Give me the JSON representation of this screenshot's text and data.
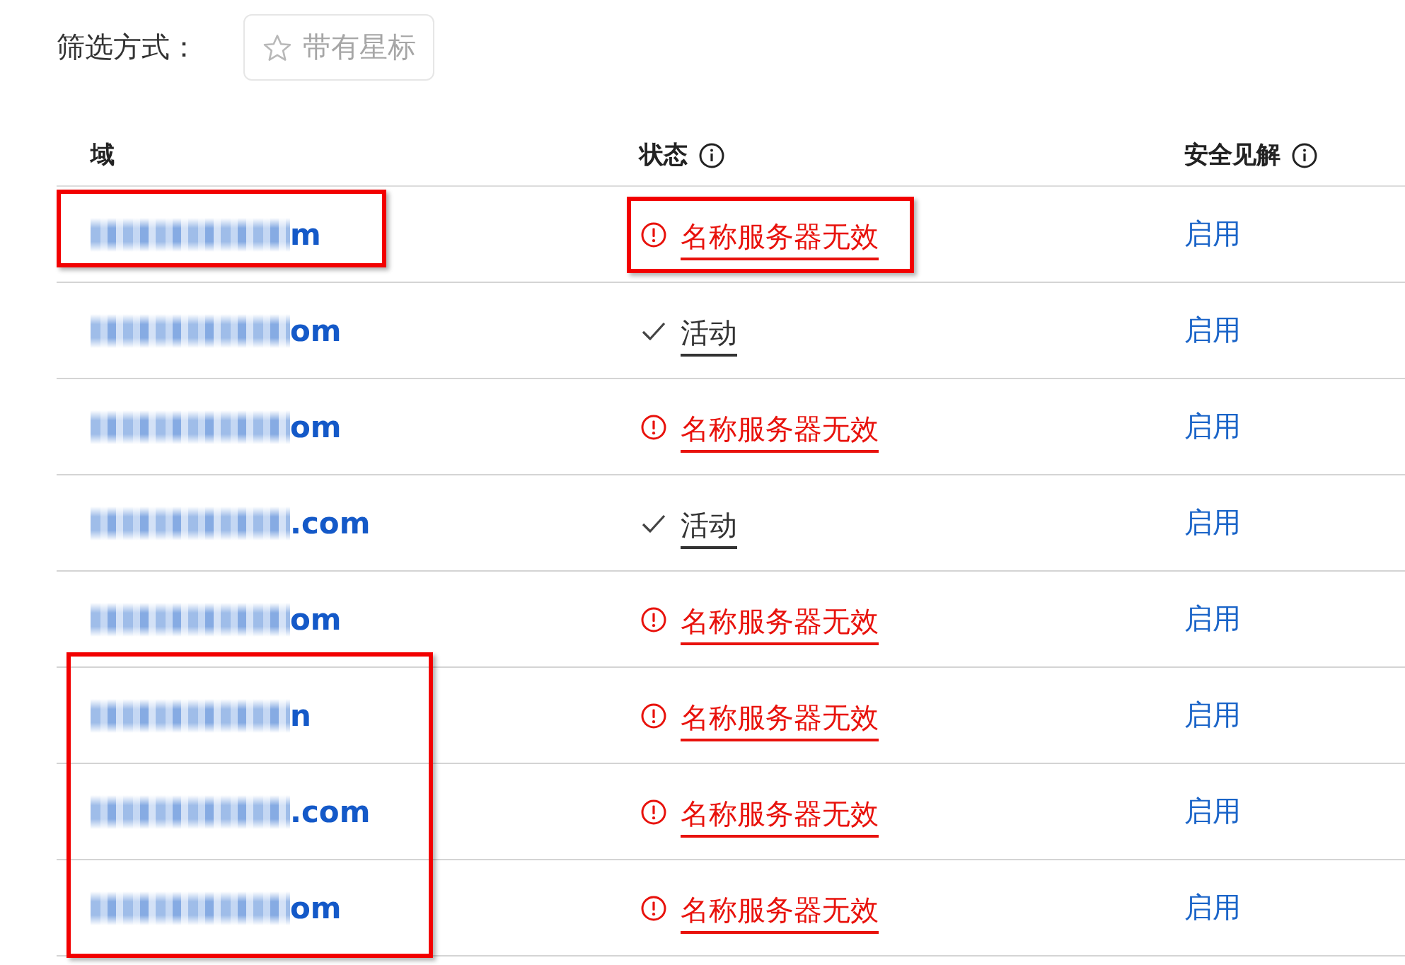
{
  "filter": {
    "label": "筛选方式：",
    "starred_button": {
      "label": "带有星标",
      "selected": false
    }
  },
  "table": {
    "columns": [
      {
        "label": "域",
        "info": false
      },
      {
        "label": "状态",
        "info": true
      },
      {
        "label": "安全见解",
        "info": true
      }
    ],
    "rows": [
      {
        "domain": "m",
        "domain_redacted": true,
        "domain_marked": true,
        "status": {
          "kind": "error",
          "label": "名称服务器无效",
          "marked": true
        },
        "insight": "启用"
      },
      {
        "domain": "om",
        "domain_redacted": true,
        "domain_marked": false,
        "status": {
          "kind": "ok",
          "label": "活动",
          "marked": false
        },
        "insight": "启用"
      },
      {
        "domain": "om",
        "domain_redacted": true,
        "domain_marked": false,
        "status": {
          "kind": "error",
          "label": "名称服务器无效",
          "marked": false
        },
        "insight": "启用"
      },
      {
        "domain": ".com",
        "domain_redacted": true,
        "domain_marked": false,
        "status": {
          "kind": "ok",
          "label": "活动",
          "marked": false
        },
        "insight": "启用"
      },
      {
        "domain": "om",
        "domain_redacted": true,
        "domain_marked": false,
        "status": {
          "kind": "error",
          "label": "名称服务器无效",
          "marked": false
        },
        "insight": "启用"
      },
      {
        "domain": "n",
        "domain_redacted": true,
        "domain_marked": true,
        "status": {
          "kind": "error",
          "label": "名称服务器无效",
          "marked": false
        },
        "insight": "启用"
      },
      {
        "domain": ".com",
        "domain_redacted": true,
        "domain_marked": true,
        "status": {
          "kind": "error",
          "label": "名称服务器无效",
          "marked": false
        },
        "insight": "启用"
      },
      {
        "domain": "om",
        "domain_redacted": true,
        "domain_marked": true,
        "status": {
          "kind": "error",
          "label": "名称服务器无效",
          "marked": false
        },
        "insight": "启用"
      }
    ]
  }
}
